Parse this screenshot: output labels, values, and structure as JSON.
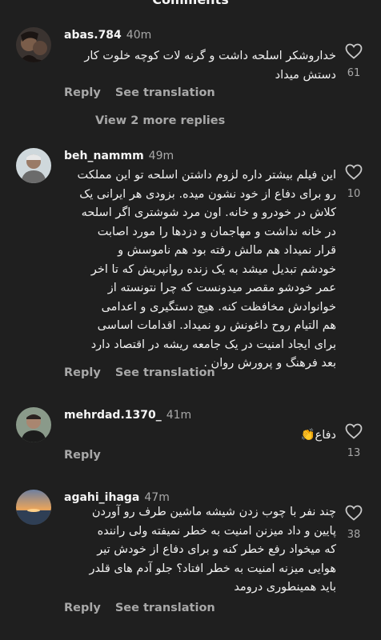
{
  "header": {
    "title": "Comments"
  },
  "view_replies_label": "View 2 more replies",
  "comments": [
    {
      "username": "abas.784",
      "time": "40m",
      "lines": [
        "خداروشکر اسلحه داشت و گرنه لات کوچه خلوت کار",
        "دستش میداد"
      ],
      "reply_label": "Reply",
      "translate_label": "See translation",
      "likes": "61"
    },
    {
      "username": "beh_nammm",
      "time": "49m",
      "lines": [
        "این فیلم بیشتر داره لزوم داشتن اسلحه تو این مملکت",
        "رو برای دفاع از خود نشون میده. بزودی هر ایرانی یک",
        "کلاش در خودرو و خانه. اون مرد شوشتری اگر اسلحه",
        "در خانه نداشت و مهاجمان و دزدها را مورد اصابت",
        "قرار نمیداد هم مالش رفته بود هم ناموسش و",
        "خودشم تبدیل میشد به یک زنده روانپریش که تا اخر",
        "عمر خودشو مقصر میدونست که چرا نتونسته از",
        "خوانوادش مخافظت کنه. هیچ دستگیری و اعدامی",
        "هم التیام روح داغونش رو نمیداد. اقدامات اساسی",
        "برای ایجاد امنیت در یک جامعه ریشه در اقتصاد دارد",
        "بعد فرهنگ و پرورش روان ."
      ],
      "reply_label": "Reply",
      "translate_label": "See translation",
      "likes": "10"
    },
    {
      "username": "mehrdad.1370_",
      "time": "41m",
      "lines": [
        "دفاع👏"
      ],
      "reply_label": "Reply",
      "likes": "13"
    },
    {
      "username": "agahi_ihaga",
      "time": "47m",
      "lines": [
        "چند نفر با چوب زدن شیشه ماشین طرف رو آوردن",
        "پایین و داد میزنن امنیت به خطر نمیفته ولی راننده",
        "که میخواد رفع خطر کنه و برای دفاع از خودش تیر",
        "هوایی میزنه امنیت به خطر افتاد؟ جلو آدم های قلدر",
        "باید همینطوری درومد"
      ],
      "reply_label": "Reply",
      "translate_label": "See translation",
      "likes": "38"
    }
  ],
  "icons": {
    "like": "heart-outline-icon"
  }
}
